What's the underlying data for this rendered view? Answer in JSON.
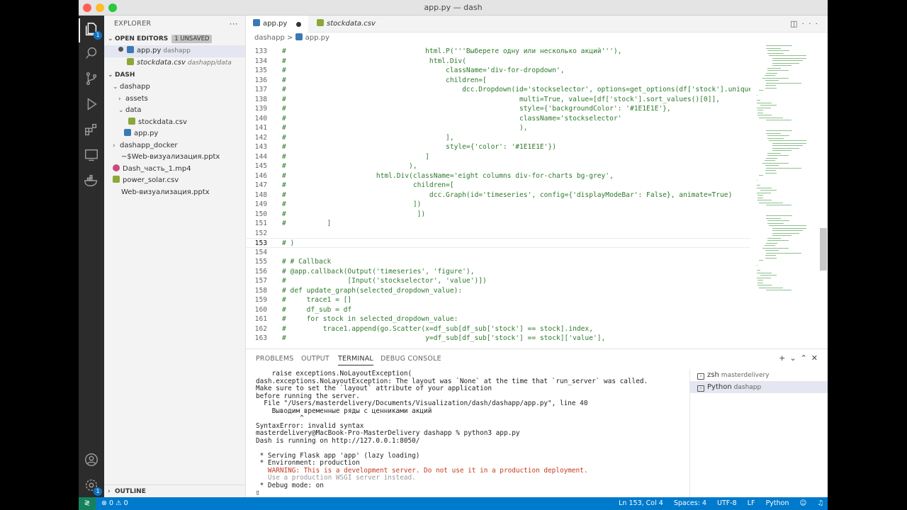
{
  "window": {
    "title": "app.py — dash"
  },
  "activity": {
    "explorer_badge": "1",
    "settings_badge": "1"
  },
  "sidebar": {
    "header": "EXPLORER",
    "open_editors": {
      "label": "OPEN EDITORS",
      "badge": "1 UNSAVED"
    },
    "open_files": [
      {
        "name": "app.py",
        "desc": "dashapp"
      },
      {
        "name": "stockdata.csv",
        "desc": "dashapp/data"
      }
    ],
    "folder": "DASH",
    "tree": [
      {
        "name": "dashapp"
      },
      {
        "name": "assets"
      },
      {
        "name": "data"
      },
      {
        "name": "stockdata.csv"
      },
      {
        "name": "app.py"
      },
      {
        "name": "dashapp_docker"
      },
      {
        "name": "~$Web-визуализация.pptx"
      },
      {
        "name": "Dash_часть_1.mp4"
      },
      {
        "name": "power_solar.csv"
      },
      {
        "name": "Web-визуализация.pptx"
      }
    ],
    "outline": "OUTLINE"
  },
  "tabs": [
    {
      "name": "app.py"
    },
    {
      "name": "stockdata.csv"
    }
  ],
  "breadcrumbs": {
    "folder": "dashapp",
    "file": "app.py",
    "sep": ">"
  },
  "code": [
    {
      "n": "133",
      "t": "#                                  html.P('''Выберете одну или несколько акций'''),"
    },
    {
      "n": "134",
      "t": "#                                   html.Div("
    },
    {
      "n": "135",
      "t": "#                                       className='div-for-dropdown',"
    },
    {
      "n": "136",
      "t": "#                                       children=["
    },
    {
      "n": "137",
      "t": "#                                           dcc.Dropdown(id='stockselector', options=get_options(df['stock'].unique()),"
    },
    {
      "n": "138",
      "t": "#                                                         multi=True, value=[df['stock'].sort_values()[0]],"
    },
    {
      "n": "139",
      "t": "#                                                         style={'backgroundColor': '#1E1E1E'},"
    },
    {
      "n": "140",
      "t": "#                                                         className='stockselector'"
    },
    {
      "n": "141",
      "t": "#                                                         ),"
    },
    {
      "n": "142",
      "t": "#                                       ],"
    },
    {
      "n": "143",
      "t": "#                                       style={'color': '#1E1E1E'})"
    },
    {
      "n": "144",
      "t": "#                                  ]"
    },
    {
      "n": "145",
      "t": "#                              ),"
    },
    {
      "n": "146",
      "t": "#                      html.Div(className='eight columns div-for-charts bg-grey',"
    },
    {
      "n": "147",
      "t": "#                               children=["
    },
    {
      "n": "148",
      "t": "#                                   dcc.Graph(id='timeseries', config={'displayModeBar': False}, animate=True)"
    },
    {
      "n": "149",
      "t": "#                               ])"
    },
    {
      "n": "150",
      "t": "#                                ])"
    },
    {
      "n": "151",
      "t": "#          ]"
    },
    {
      "n": "152",
      "t": ""
    },
    {
      "n": "153",
      "t": "# )"
    },
    {
      "n": "154",
      "t": ""
    },
    {
      "n": "155",
      "t": "# # Callback"
    },
    {
      "n": "156",
      "t": "# @app.callback(Output('timeseries', 'figure'),"
    },
    {
      "n": "157",
      "t": "#               [Input('stockselector', 'value')])"
    },
    {
      "n": "158",
      "t": "# def update_graph(selected_dropdown_value):"
    },
    {
      "n": "159",
      "t": "#     trace1 = []"
    },
    {
      "n": "160",
      "t": "#     df_sub = df"
    },
    {
      "n": "161",
      "t": "#     for stock in selected_dropdown_value:"
    },
    {
      "n": "162",
      "t": "#         trace1.append(go.Scatter(x=df_sub[df_sub['stock'] == stock].index,"
    },
    {
      "n": "163",
      "t": "#                                  y=df_sub[df_sub['stock'] == stock]['value'],"
    }
  ],
  "panel": {
    "tabs": [
      "PROBLEMS",
      "OUTPUT",
      "TERMINAL",
      "DEBUG CONSOLE"
    ],
    "terminal_lines": [
      "    raise exceptions.NoLayoutException(",
      "dash.exceptions.NoLayoutException: The layout was `None` at the time that `run_server` was called.",
      "Make sure to set the `layout` attribute of your application",
      "before running the server.",
      "  File \"/Users/masterdelivery/Documents/Visualization/dash/dashapp/app.py\", line 40",
      "    Выводим временные ряды с ценниками акций",
      "           ^",
      "SyntaxError: invalid syntax",
      "masterdelivery@MacBook-Pro-MasterDelivery dashapp % python3 app.py",
      "Dash is running on http://127.0.0.1:8050/",
      "",
      " * Serving Flask app 'app' (lazy loading)",
      " * Environment: production",
      "   WARNING: This is a development server. Do not use it in a production deployment.",
      "   Use a production WSGI server instead.",
      " * Debug mode: on",
      "▯"
    ],
    "terminals": [
      {
        "name": "zsh",
        "sub": "masterdelivery"
      },
      {
        "name": "Python",
        "sub": "dashapp"
      }
    ]
  },
  "status": {
    "errors": "⊗ 0",
    "warnings": "⚠ 0",
    "position": "Ln 153, Col 4",
    "spaces": "Spaces: 4",
    "encoding": "UTF-8",
    "eol": "LF",
    "language": "Python"
  }
}
